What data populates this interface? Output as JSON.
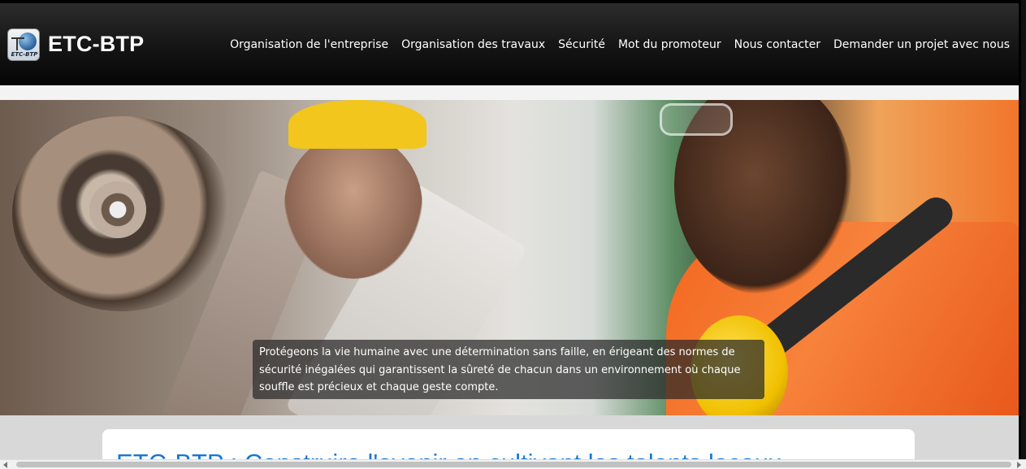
{
  "brand": {
    "name": "ETC-BTP",
    "logo_text": "ETC-BTP"
  },
  "nav": {
    "items": [
      "Organisation de l'entreprise",
      "Organisation des travaux",
      "Sécurité",
      "Mot du promoteur",
      "Nous contacter",
      "Demander un projet avec nous"
    ]
  },
  "hero": {
    "caption": "Protégeons la vie humaine avec une détermination sans faille, en érigeant des normes de sécurité inégalées qui garantissent la sûreté de chacun dans un environnement où chaque souffle est précieux et chaque geste compte."
  },
  "section": {
    "title": "ETC-BTP : Construire l'avenir en cultivant les talents locaux"
  },
  "colors": {
    "navbar": "#111111",
    "title_blue": "#1877d2",
    "helmet_yellow": "#f2c61c",
    "jacket_orange": "#f2661f"
  }
}
